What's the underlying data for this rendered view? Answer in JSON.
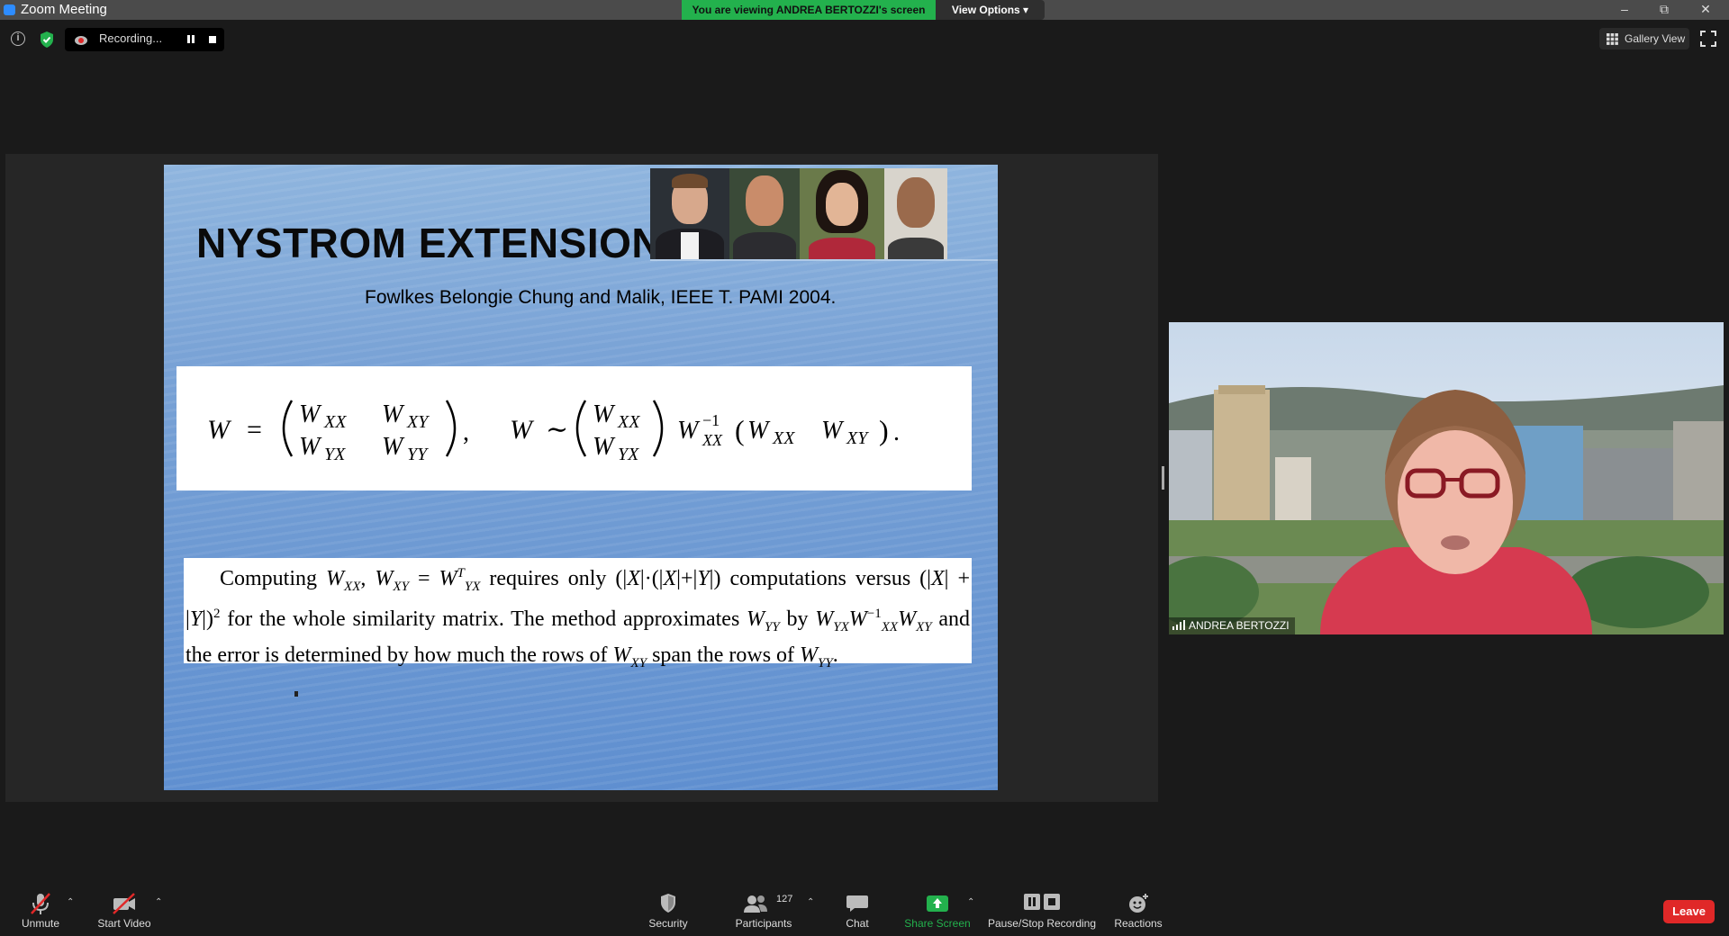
{
  "window": {
    "title": "Zoom Meeting"
  },
  "banner": {
    "viewing_text": "You are viewing ANDREA BERTOZZI's screen",
    "view_options_label": "View Options"
  },
  "recording": {
    "status_text": "Recording..."
  },
  "gallery": {
    "label": "Gallery View"
  },
  "slide": {
    "title": "NYSTROM EXTENSION",
    "subtitle": "Fowlkes Belongie Chung and Malik, IEEE T. PAMI 2004."
  },
  "speaker": {
    "name": "ANDREA BERTOZZI"
  },
  "toolbar": {
    "unmute_label": "Unmute",
    "start_video_label": "Start Video",
    "security_label": "Security",
    "participants_label": "Participants",
    "participants_count": "127",
    "chat_label": "Chat",
    "share_screen_label": "Share Screen",
    "pause_stop_label": "Pause/Stop Recording",
    "reactions_label": "Reactions",
    "leave_label": "Leave"
  },
  "colors": {
    "banner_green": "#23b14d",
    "share_green": "#23b14d",
    "leave_red": "#e02828",
    "muted_red": "#e02828"
  }
}
